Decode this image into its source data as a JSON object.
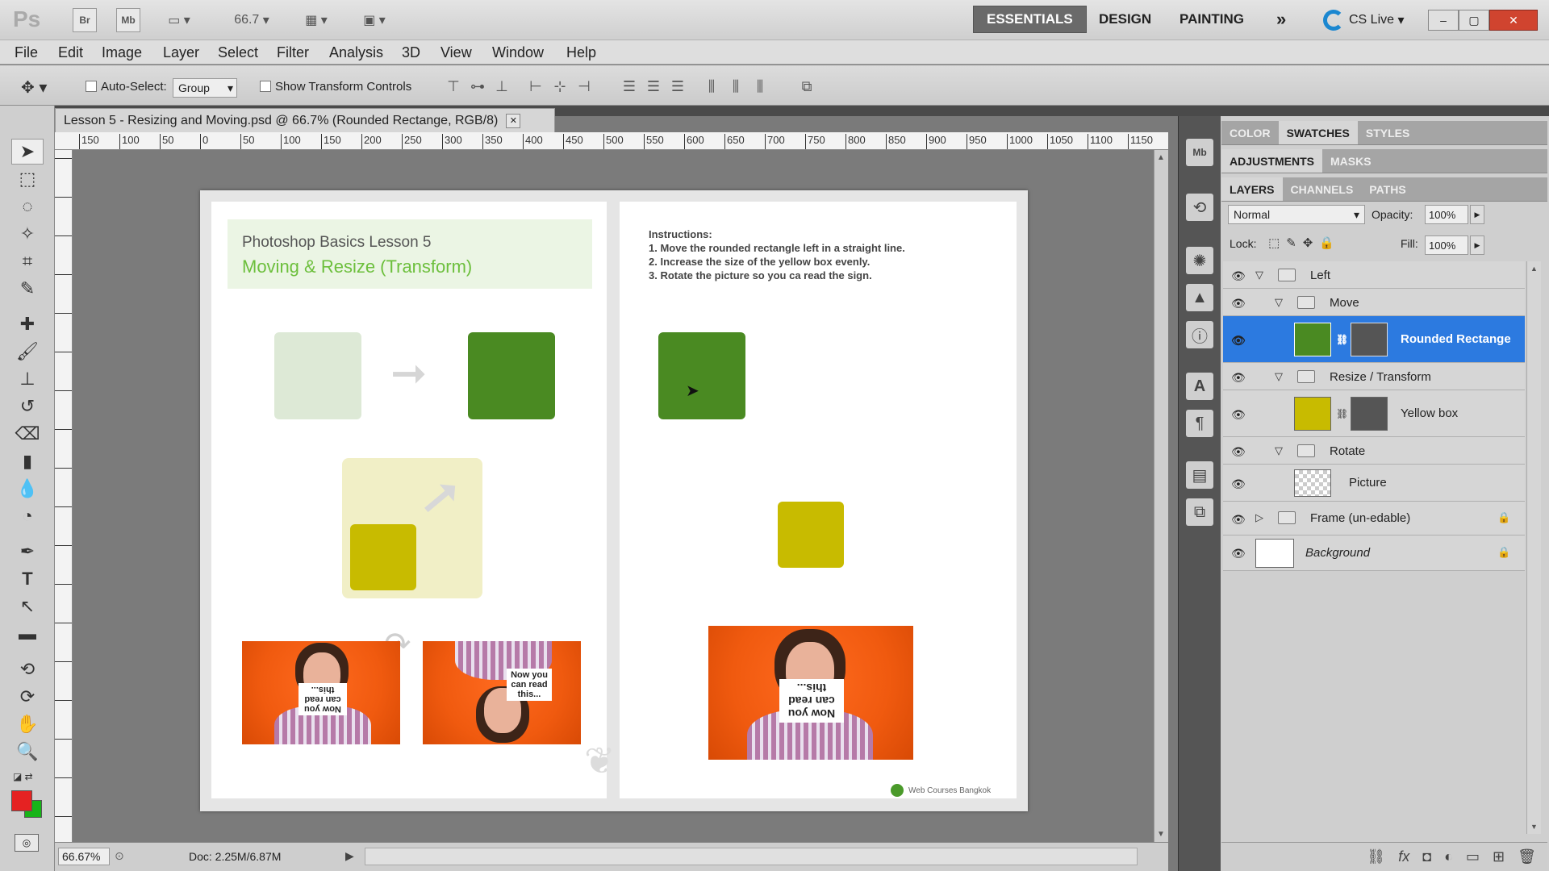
{
  "app": {
    "logo": "Ps",
    "br": "Br",
    "mb": "Mb",
    "zoom": "66.7",
    "workspaces": [
      "ESSENTIALS",
      "DESIGN",
      "PAINTING"
    ],
    "more": "»",
    "cslive": "CS Live",
    "window_controls": [
      "–",
      "▢",
      "✕"
    ]
  },
  "menu": [
    "File",
    "Edit",
    "Image",
    "Layer",
    "Select",
    "Filter",
    "Analysis",
    "3D",
    "View",
    "Window",
    "Help"
  ],
  "options": {
    "auto_select_label": "Auto-Select:",
    "auto_select_value": "Group",
    "show_transform_label": "Show Transform Controls"
  },
  "document": {
    "tab_title": "Lesson 5 - Resizing and Moving.psd @ 66.7% (Rounded Rectange, RGB/8)",
    "close": "✕",
    "ruler_labels": [
      "150",
      "100",
      "50",
      "0",
      "50",
      "100",
      "150",
      "200",
      "250",
      "300",
      "350",
      "400",
      "450",
      "500",
      "550",
      "600",
      "650",
      "700",
      "750",
      "800",
      "850",
      "900",
      "950",
      "1000",
      "1050",
      "1100",
      "1150"
    ]
  },
  "page_left": {
    "title_line1": "Photoshop Basics Lesson 5",
    "title_line2": "Moving & Resize (Transform)",
    "sign_text": "Now you can read this..."
  },
  "page_right": {
    "instructions_heading": "Instructions:",
    "instructions": [
      "1. Move the rounded rectangle left in a straight line.",
      "2. Increase the size of the yellow box evenly.",
      "3. Rotate the picture so you ca read the sign."
    ],
    "footer_brand": "Web Courses Bangkok",
    "sign_text": "Now you can read this..."
  },
  "status": {
    "zoom": "66.67%",
    "doc": "Doc: 2.25M/6.87M"
  },
  "panels": {
    "tabs_row1": [
      "COLOR",
      "SWATCHES",
      "STYLES"
    ],
    "tabs_row2": [
      "ADJUSTMENTS",
      "MASKS"
    ],
    "tabs_row3": [
      "LAYERS",
      "CHANNELS",
      "PATHS"
    ],
    "blend_mode": "Normal",
    "opacity_label": "Opacity:",
    "opacity_value": "100%",
    "lock_label": "Lock:",
    "fill_label": "Fill:",
    "fill_value": "100%",
    "layers": [
      {
        "name": "Left"
      },
      {
        "name": "Move"
      },
      {
        "name": "Rounded Rectange"
      },
      {
        "name": "Resize / Transform"
      },
      {
        "name": "Yellow box"
      },
      {
        "name": "Rotate"
      },
      {
        "name": "Picture"
      },
      {
        "name": "Frame (un-edable)"
      },
      {
        "name": "Background"
      }
    ]
  },
  "colors": {
    "green": "#4a8a22",
    "yellow": "#c8bb00",
    "orange": "#f05a0f",
    "selection": "#2c7ae0"
  }
}
